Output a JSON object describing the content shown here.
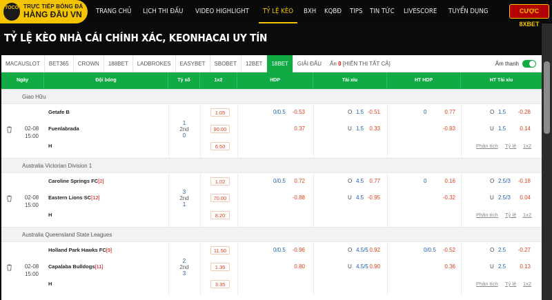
{
  "logo": {
    "line1": "TRỰC TIẾP BÓNG ĐÁ",
    "line2": "HÀNG ĐẦU VN",
    "badge": "TOCO"
  },
  "nav": [
    "TRANG CHỦ",
    "LỊCH THI ĐẤU",
    "VIDEO HIGHLIGHT",
    "TỶ LỆ KÈO",
    "BXH",
    "KQBĐ",
    "TIPS",
    "TIN TỨC",
    "LIVESCORE",
    "TUYỂN DỤNG"
  ],
  "nav_active": 3,
  "cta": "CƯỢC 8XBET",
  "heading": "TỶ LỆ KÈO NHÀ CÁI CHÍNH XÁC, KEONHACAI UY TÍN",
  "tabs": [
    "MACAUSLOT",
    "BET365",
    "CROWN",
    "188BET",
    "LADBROKES",
    "EASYBET",
    "SBOBET",
    "12BET",
    "18BET",
    "GIẢI ĐẤU"
  ],
  "tab_active": 8,
  "hidden": {
    "label": "Ẩn",
    "count": "0",
    "show_all": "[HIỂN THỊ TẤT CẢ]"
  },
  "sound_label": "Âm thanh",
  "columns": [
    "Ngày",
    "Đội bóng",
    "Tỷ số",
    "1x2",
    "HDP",
    "Tài xỉu",
    "HT HDP",
    "HT Tài xỉu"
  ],
  "links": [
    "Phân tích",
    "Tỷ lệ",
    "1x2"
  ],
  "groups": [
    {
      "league": "Giao Hữu",
      "date": "02-08",
      "time": "15:00",
      "home": "Getafe B",
      "home_rank": "",
      "away": "Fuenlabrada",
      "away_rank": "",
      "draw": "H",
      "score_top": "1",
      "score_mid": "2nd",
      "score_bot": "0",
      "x12": [
        "1.05",
        "90.00",
        "6.50"
      ],
      "hdp_line": "0/0.5",
      "hdp": [
        "-0.53",
        "0.37"
      ],
      "tx_o": "O",
      "tx_line_o": "1.5",
      "tx_u": "U",
      "tx_line_u": "1.5",
      "tx": [
        "-0.51",
        "0.33"
      ],
      "ht_hdp_line": "0",
      "ht_hdp": [
        "0.77",
        "-0.93"
      ],
      "ht_tx_o": "O",
      "ht_tx_line_o": "1.5",
      "ht_tx_u": "U",
      "ht_tx_line_u": "1.5",
      "ht_tx": [
        "-0.28",
        "0.14"
      ]
    },
    {
      "league": "Australia Victorian Division 1",
      "date": "02-08",
      "time": "15:00",
      "home": "Caroline Springs FC",
      "home_rank": "[2]",
      "away": "Eastern Lions SC",
      "away_rank": "[12]",
      "draw": "H",
      "score_top": "3",
      "score_mid": "2nd",
      "score_bot": "1",
      "x12": [
        "1.02",
        "70.00",
        "8.20"
      ],
      "hdp_line": "0/0.5",
      "hdp": [
        "0.72",
        "-0.88"
      ],
      "tx_o": "O",
      "tx_line_o": "4.5",
      "tx_u": "U",
      "tx_line_u": "4.5",
      "tx": [
        "0.77",
        "-0.95"
      ],
      "ht_hdp_line": "0",
      "ht_hdp": [
        "0.16",
        "-0.32"
      ],
      "ht_tx_o": "O",
      "ht_tx_line_o": "2.5/3",
      "ht_tx_u": "U",
      "ht_tx_line_u": "2.5/3",
      "ht_tx": [
        "-0.18",
        "0.04"
      ]
    },
    {
      "league": "Australia Queensland State Leagues",
      "date": "02-08",
      "time": "15:00",
      "home": "Holland Park Hawks FC",
      "home_rank": "[9]",
      "away": "Capalaba Bulldogs",
      "away_rank": "[11]",
      "draw": "H",
      "score_top": "2",
      "score_mid": "2nd",
      "score_bot": "3",
      "x12": [
        "11.50",
        "1.35",
        "3.35"
      ],
      "hdp_line": "0/0.5",
      "hdp": [
        "-0.96",
        "0.80"
      ],
      "tx_o": "O",
      "tx_line_o": "4.5/5",
      "tx_u": "U",
      "tx_line_u": "4.5/5",
      "tx": [
        "0.92",
        "0.90"
      ],
      "ht_hdp_line": "0/0.5",
      "ht_hdp": [
        "-0.52",
        "0.36"
      ],
      "ht_tx_o": "O",
      "ht_tx_line_o": "2.5",
      "ht_tx_u": "U",
      "ht_tx_line_u": "2.5",
      "ht_tx": [
        "-0.27",
        "0.13"
      ]
    }
  ]
}
